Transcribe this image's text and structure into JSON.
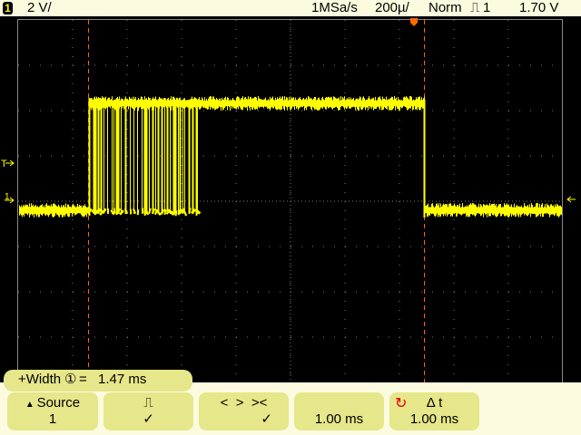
{
  "header": {
    "channel": "1",
    "volts_per_div": "2 V/",
    "sample_rate": "1MSa/s",
    "time_per_div": "200µ/",
    "trigger_mode": "Norm",
    "trigger_type_icon": "rising-pulse-icon",
    "trigger_source": "1",
    "trigger_level": "1.70 V"
  },
  "markers": {
    "trigger_level": "T",
    "channel_ground": "1"
  },
  "measurement": {
    "label": "+Width",
    "source": "①",
    "eq": "=",
    "value": "1.47 ms"
  },
  "softkeys": [
    {
      "line1": "Source",
      "line2": "1"
    },
    {
      "line1": "⎍",
      "line2": "✓"
    },
    {
      "line1": "<  >  ><",
      "line2": "✓"
    },
    {
      "line1": "",
      "line2": "1.00 ms"
    },
    {
      "line1": "Δ t",
      "line2": "1.00 ms"
    }
  ],
  "colors": {
    "trace": "#ffff00",
    "cursor": "#ff6a00",
    "grid": "#7a7a7a",
    "softkey": "#e6e68a"
  }
}
